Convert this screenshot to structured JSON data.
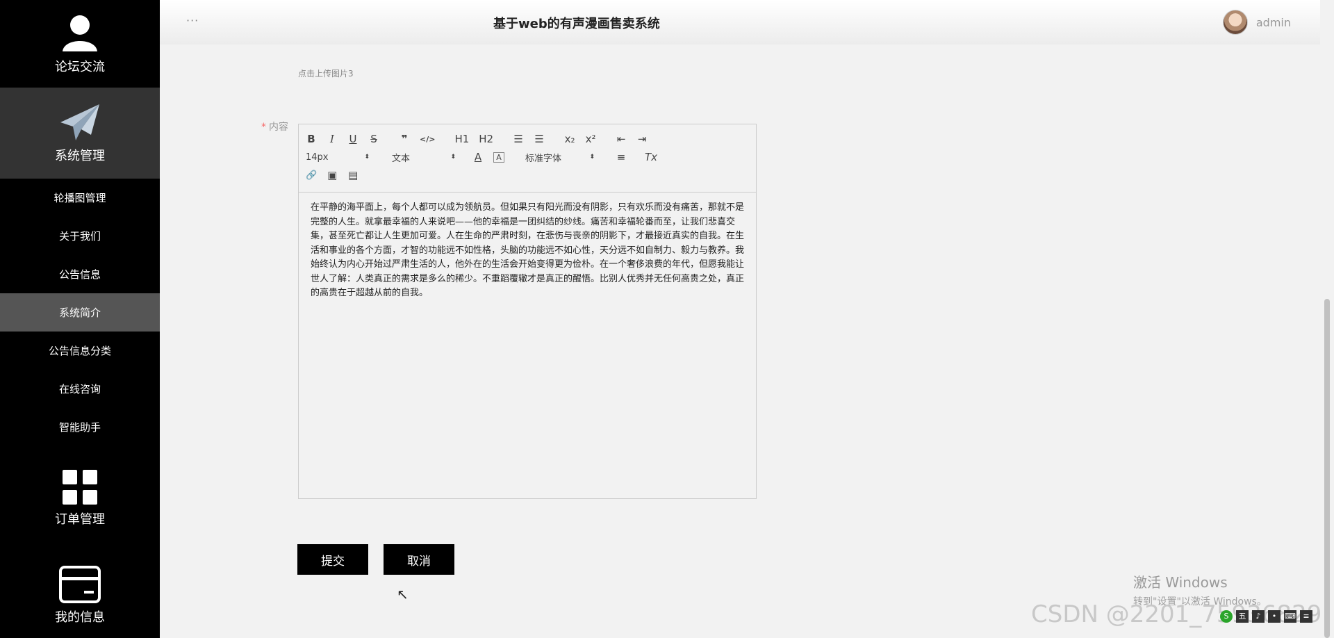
{
  "sidebar": {
    "forum": {
      "label": "论坛交流",
      "icon": "user-icon"
    },
    "system": {
      "label": "系统管理",
      "icon": "paper-plane-icon"
    },
    "items": [
      {
        "label": "轮播图管理"
      },
      {
        "label": "关于我们"
      },
      {
        "label": "公告信息"
      },
      {
        "label": "系统简介",
        "active": true
      },
      {
        "label": "公告信息分类"
      },
      {
        "label": "在线咨询"
      },
      {
        "label": "智能助手"
      }
    ],
    "order": {
      "label": "订单管理",
      "icon": "grid-icon"
    },
    "mine": {
      "label": "我的信息",
      "icon": "card-icon"
    }
  },
  "header": {
    "dots": "···",
    "title": "基于web的有声漫画售卖系统",
    "username": "admin"
  },
  "form": {
    "upload_hint": "点击上传图片3",
    "content_label": "内容",
    "required_mark": "*",
    "toolbar": {
      "bold": "B",
      "italic": "I",
      "underline": "U",
      "strike": "S",
      "quote": "❞",
      "code": "</>",
      "h1": "H1",
      "h2": "H2",
      "ol": "☰",
      "ul": "☰",
      "sub": "x₂",
      "sup": "x²",
      "outdent": "⇤",
      "indent": "⇥",
      "size": "14px",
      "header_select": "文本",
      "color": "A",
      "background": "A",
      "font": "标准字体",
      "align": "≡",
      "clean": "Tx",
      "link": "🔗",
      "image": "▣",
      "video": "▤"
    },
    "content": "在平静的海平面上，每个人都可以成为领航员。但如果只有阳光而没有阴影，只有欢乐而没有痛苦，那就不是完整的人生。就拿最幸福的人来说吧——他的幸福是一团纠结的纱线。痛苦和幸福轮番而至，让我们悲喜交集，甚至死亡都让人生更加可爱。人在生命的严肃时刻，在悲伤与丧亲的阴影下，才最接近真实的自我。在生活和事业的各个方面，才智的功能远不如性格，头脑的功能远不如心性，天分远不如自制力、毅力与教养。我始终认为内心开始过严肃生活的人，他外在的生活会开始变得更为俭朴。在一个奢侈浪费的年代，但愿我能让世人了解：人类真正的需求是多么的稀少。不重蹈覆辙才是真正的醒悟。比别人优秀并无任何高贵之处，真正的高贵在于超越从前的自我。",
    "submit": "提交",
    "cancel": "取消"
  },
  "overlay": {
    "activate_title": "激活 Windows",
    "activate_sub": "转到\"设置\"以激活 Windows。",
    "csdn": "CSDN @2201_75936829"
  }
}
